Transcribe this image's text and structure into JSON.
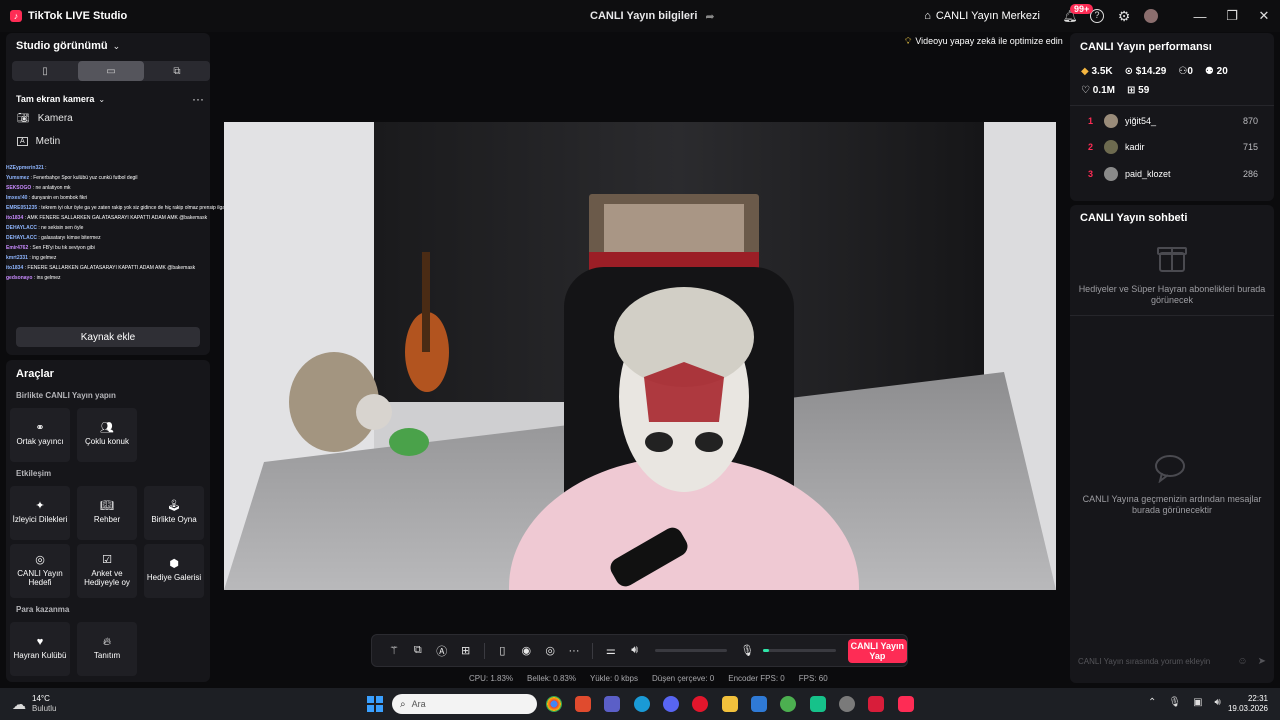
{
  "titlebar": {
    "app_title": "TikTok LIVE Studio",
    "live_info": "CANLI Yayın bilgileri",
    "live_center": "CANLI Yayın Merkezi",
    "notif_count": "99+"
  },
  "left": {
    "studio_view": "Studio görünümü",
    "fullscreen_camera": "Tam ekran kamera",
    "sources": [
      "Kamera",
      "Metin"
    ],
    "chat_lines": [
      {
        "user": "HZEypmerin321",
        "msg": ""
      },
      {
        "user": "Yumsmez",
        "msg": "Fenerbahçe Spor kulübü yuz cunkü futbol degil"
      },
      {
        "user": "SEKSOGO",
        "msg": "ne anlatiyon mk"
      },
      {
        "user": "Imxes!40",
        "msg": "dunyanin en bombok fikri"
      },
      {
        "user": "EMRE051235",
        "msg": "tekrem iyi olur öyle ga ye zaten rakip yok siz gidince de hiç rakip olmaz prensip ilga falan giderlz"
      },
      {
        "user": "ito1834",
        "msg": "AMK FENERE SALLARKEN GALATASARAYI KAPATTI ADAM AMK @bakemask"
      },
      {
        "user": "DEHAYLACC",
        "msg": "ne sekisin sen öyle"
      },
      {
        "user": "DEHAYLACC",
        "msg": "galasataryı kimse bitermez"
      },
      {
        "user": "Emir4762",
        "msg": "Sen FB'yi bu tık seviyon gibi"
      },
      {
        "user": "kmrt2331",
        "msg": "ing gelmez"
      },
      {
        "user": "ito1834",
        "msg": "FENERE SALLARKEN GALATASARAYI KAPATTI ADAM AMK @bakemask"
      },
      {
        "user": "gedsonayo",
        "msg": "ins gelmez"
      }
    ],
    "add_source": "Kaynak ekle",
    "tools_title": "Araçlar",
    "sections": {
      "together": "Birlikte CANLI Yayın yapın",
      "engagement": "Etkileşim",
      "monetize": "Para kazanma"
    },
    "tools_together": [
      "Ortak yayıncı",
      "Çoklu konuk"
    ],
    "tools_engagement": [
      "İzleyici Dilekleri",
      "Rehber",
      "Birlikte Oyna",
      "CANLI Yayın Hedefi",
      "Anket ve Hediyeyle oy",
      "Hediye Galerisi"
    ],
    "tools_monetize": [
      "Hayran Kulübü",
      "Tanıtım"
    ]
  },
  "center": {
    "optimize_hint": "Videoyu yapay zekâ ile optimize edin",
    "go_live": "CANLI Yayın Yap",
    "mic_level": 0.08,
    "stats": {
      "cpu": "CPU: 1.83%",
      "memory": "Bellek: 0.83%",
      "upload": "Yükle: 0 kbps",
      "dropped": "Düşen çerçeve: 0",
      "encoder_fps": "Encoder FPS: 0",
      "fps": "FPS: 60"
    }
  },
  "right": {
    "perf_title": "CANLI Yayın performansı",
    "stats": {
      "diamonds": "3.5K",
      "money": "$14.29",
      "followers": "0",
      "viewers": "20",
      "likes": "0.1M",
      "gifts": "59"
    },
    "top_viewers": [
      {
        "rank": "1",
        "name": "yiğit54_",
        "score": "870"
      },
      {
        "rank": "2",
        "name": "kadir",
        "score": "715"
      },
      {
        "rank": "3",
        "name": "paid_klozet",
        "score": "286"
      }
    ],
    "chat_title": "CANLI Yayın sohbeti",
    "gifts_empty": "Hediyeler ve Süper Hayran abonelikleri burada görünecek",
    "messages_empty": "CANLI Yayına geçmenizin ardından mesajlar burada görünecektir",
    "comment_placeholder": "CANLI Yayın sırasında yorum ekleyin"
  },
  "taskbar": {
    "weather_temp": "14°C",
    "weather_desc": "Bulutlu",
    "search_placeholder": "Ara",
    "time": "22:31",
    "date": "19.03.2026"
  },
  "colors": {
    "accent": "#fe2c55",
    "panel": "#16161a",
    "bg": "#0b0b0d"
  }
}
